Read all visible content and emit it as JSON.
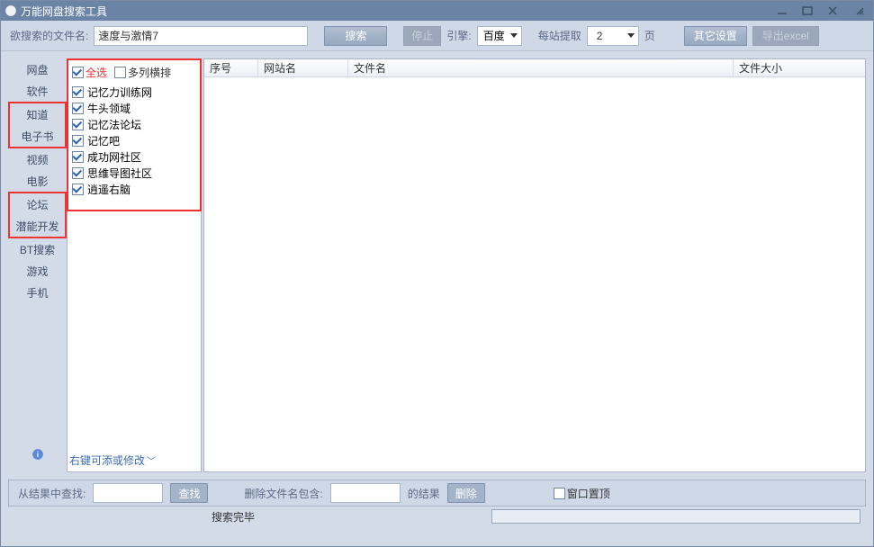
{
  "window": {
    "title": "万能网盘搜索工具"
  },
  "toolbar": {
    "search_label": "欲搜索的文件名:",
    "search_value": "速度与激情7",
    "btn_search": "搜索",
    "btn_stop": "停止",
    "engine_label": "引擎:",
    "engine_selected": "百度",
    "per_site_label": "每站提取",
    "per_site_value": "2",
    "page_unit": "页",
    "btn_other": "其它设置",
    "btn_export": "导出excel"
  },
  "sidebar": {
    "items": [
      "网盘",
      "软件",
      "知道",
      "电子书",
      "视频",
      "电影",
      "论坛",
      "潜能开发",
      "BT搜索",
      "游戏",
      "手机"
    ]
  },
  "sourcePanel": {
    "select_all_label": "全选",
    "multi_col_label": "多列横排",
    "select_all_checked": true,
    "multi_col_checked": false,
    "items": [
      {
        "checked": true,
        "label": "记忆力训练网"
      },
      {
        "checked": true,
        "label": "牛头领域"
      },
      {
        "checked": true,
        "label": "记忆法论坛"
      },
      {
        "checked": true,
        "label": "记忆吧"
      },
      {
        "checked": true,
        "label": "成功网社区"
      },
      {
        "checked": true,
        "label": "思维导图社区"
      },
      {
        "checked": true,
        "label": "逍遥右脑"
      }
    ],
    "hint": "右键可添或修改"
  },
  "results": {
    "columns": [
      "序号",
      "网站名",
      "文件名",
      "文件大小"
    ]
  },
  "lower": {
    "find_label": "从结果中查找:",
    "btn_find": "查找",
    "del_label": "删除文件名包含:",
    "del_suffix": "的结果",
    "btn_del": "删除",
    "pin_label": "窗口置顶",
    "pin_checked": false
  },
  "status": {
    "text": "搜索完毕"
  }
}
